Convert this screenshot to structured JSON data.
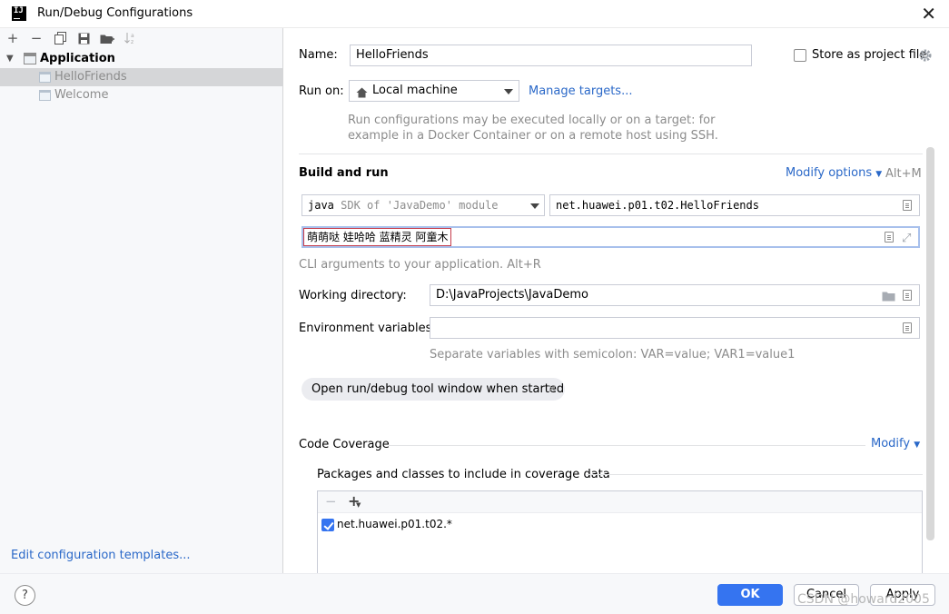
{
  "window": {
    "title": "Run/Debug Configurations",
    "logo": "IJ"
  },
  "left_toolbar": {
    "icons": [
      "add-icon",
      "remove-icon",
      "copy-icon",
      "save-icon",
      "folder-add-icon",
      "sort-icon"
    ],
    "add": "+",
    "remove": "−"
  },
  "tree": {
    "group": "Application",
    "items": [
      {
        "label": "HelloFriends",
        "selected": true
      },
      {
        "label": "Welcome",
        "selected": false
      }
    ]
  },
  "edit_templates": "Edit configuration templates...",
  "form": {
    "name_label": "Name:",
    "name_value": "HelloFriends",
    "store_label": "Store as project file",
    "run_on_label": "Run on:",
    "run_on_value": "Local machine",
    "manage_targets": "Manage targets...",
    "run_on_hint_1": "Run configurations may be executed locally or on a target: for",
    "run_on_hint_2": "example in a Docker Container or on a remote host using SSH.",
    "build_run_title": "Build and run",
    "modify_options": "Modify options",
    "modify_shortcut": "Alt+M",
    "sdk_java": "java",
    "sdk_module": "SDK of 'JavaDemo' module",
    "main_class": "net.huawei.p01.t02.HelloFriends",
    "program_args": "萌萌哒 娃哈哈 蓝精灵 阿童木",
    "cli_hint": "CLI arguments to your application. Alt+R",
    "workdir_label": "Working directory:",
    "workdir_value": "D:\\JavaProjects\\JavaDemo",
    "env_label": "Environment variables:",
    "env_value": "",
    "env_hint": "Separate variables with semicolon: VAR=value; VAR1=value1",
    "chip_label": "Open run/debug tool window when started",
    "chip_close": "✕",
    "coverage_title": "Code Coverage",
    "coverage_modify": "Modify",
    "coverage_sub": "Packages and classes to include in coverage data",
    "coverage_item": "net.huawei.p01.t02.*"
  },
  "footer": {
    "help": "?",
    "ok": "OK",
    "cancel": "Cancel",
    "apply": "Apply",
    "watermark": "CSDN @howard2005"
  },
  "colors": {
    "accent": "#3574f0",
    "link": "#2a68c8",
    "selection": "#d5d6d8",
    "highlight_border": "#c63c4b"
  }
}
